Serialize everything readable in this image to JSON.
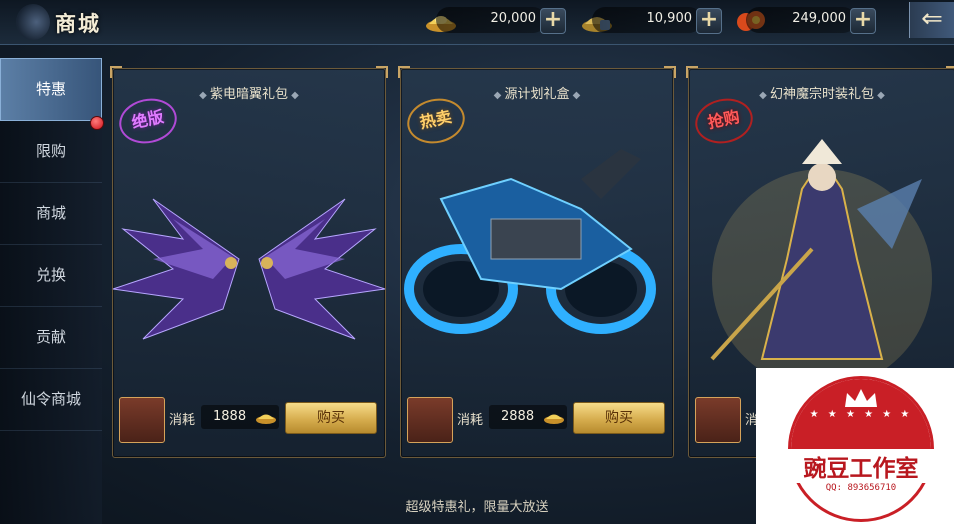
{
  "header": {
    "title": "商城",
    "currencies": [
      {
        "icon": "gold-ingot-icon",
        "value": "20,000"
      },
      {
        "icon": "bound-ingot-icon",
        "value": "10,900"
      },
      {
        "icon": "coin-pile-icon",
        "value": "249,000"
      }
    ],
    "plus_glyph": "+",
    "back_glyph": "⇐"
  },
  "sidebar": {
    "items": [
      {
        "label": "特惠",
        "active": true
      },
      {
        "label": "限购"
      },
      {
        "label": "商城"
      },
      {
        "label": "兑换"
      },
      {
        "label": "贡献"
      },
      {
        "label": "仙令商城"
      }
    ]
  },
  "cards": [
    {
      "name": "紫电暗翼礼包",
      "stamp": "绝版",
      "cost_label": "消耗",
      "cost": "1888",
      "buy_label": "购买"
    },
    {
      "name": "源计划礼盒",
      "stamp": "热卖",
      "cost_label": "消耗",
      "cost": "2888",
      "buy_label": "购买"
    },
    {
      "name": "幻神魔宗时装礼包",
      "stamp": "抢购",
      "cost_label": "消",
      "cost": "",
      "buy_label": ""
    }
  ],
  "footer": {
    "text": "超级特惠礼，限量大放送"
  },
  "watermark": {
    "text": "豌豆工作室",
    "qq": "QQ: 893656710",
    "stars": "★ ★ ★ ★ ★ ★"
  },
  "colors": {
    "accent_gold": "#d6ad4e",
    "active_tab": "#5c7fa6",
    "watermark_red": "#c91f26"
  }
}
